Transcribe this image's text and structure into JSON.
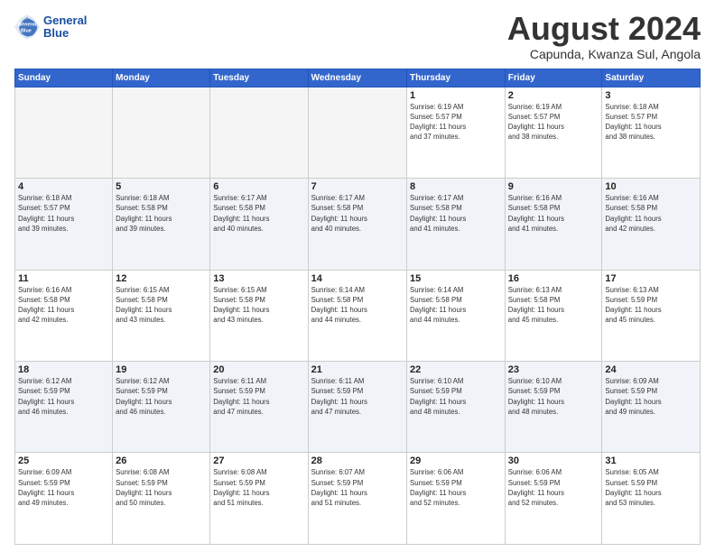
{
  "header": {
    "logo_line1": "General",
    "logo_line2": "Blue",
    "month": "August 2024",
    "location": "Capunda, Kwanza Sul, Angola"
  },
  "weekdays": [
    "Sunday",
    "Monday",
    "Tuesday",
    "Wednesday",
    "Thursday",
    "Friday",
    "Saturday"
  ],
  "rows": [
    [
      {
        "day": "",
        "info": ""
      },
      {
        "day": "",
        "info": ""
      },
      {
        "day": "",
        "info": ""
      },
      {
        "day": "",
        "info": ""
      },
      {
        "day": "1",
        "info": "Sunrise: 6:19 AM\nSunset: 5:57 PM\nDaylight: 11 hours\nand 37 minutes."
      },
      {
        "day": "2",
        "info": "Sunrise: 6:19 AM\nSunset: 5:57 PM\nDaylight: 11 hours\nand 38 minutes."
      },
      {
        "day": "3",
        "info": "Sunrise: 6:18 AM\nSunset: 5:57 PM\nDaylight: 11 hours\nand 38 minutes."
      }
    ],
    [
      {
        "day": "4",
        "info": "Sunrise: 6:18 AM\nSunset: 5:57 PM\nDaylight: 11 hours\nand 39 minutes."
      },
      {
        "day": "5",
        "info": "Sunrise: 6:18 AM\nSunset: 5:58 PM\nDaylight: 11 hours\nand 39 minutes."
      },
      {
        "day": "6",
        "info": "Sunrise: 6:17 AM\nSunset: 5:58 PM\nDaylight: 11 hours\nand 40 minutes."
      },
      {
        "day": "7",
        "info": "Sunrise: 6:17 AM\nSunset: 5:58 PM\nDaylight: 11 hours\nand 40 minutes."
      },
      {
        "day": "8",
        "info": "Sunrise: 6:17 AM\nSunset: 5:58 PM\nDaylight: 11 hours\nand 41 minutes."
      },
      {
        "day": "9",
        "info": "Sunrise: 6:16 AM\nSunset: 5:58 PM\nDaylight: 11 hours\nand 41 minutes."
      },
      {
        "day": "10",
        "info": "Sunrise: 6:16 AM\nSunset: 5:58 PM\nDaylight: 11 hours\nand 42 minutes."
      }
    ],
    [
      {
        "day": "11",
        "info": "Sunrise: 6:16 AM\nSunset: 5:58 PM\nDaylight: 11 hours\nand 42 minutes."
      },
      {
        "day": "12",
        "info": "Sunrise: 6:15 AM\nSunset: 5:58 PM\nDaylight: 11 hours\nand 43 minutes."
      },
      {
        "day": "13",
        "info": "Sunrise: 6:15 AM\nSunset: 5:58 PM\nDaylight: 11 hours\nand 43 minutes."
      },
      {
        "day": "14",
        "info": "Sunrise: 6:14 AM\nSunset: 5:58 PM\nDaylight: 11 hours\nand 44 minutes."
      },
      {
        "day": "15",
        "info": "Sunrise: 6:14 AM\nSunset: 5:58 PM\nDaylight: 11 hours\nand 44 minutes."
      },
      {
        "day": "16",
        "info": "Sunrise: 6:13 AM\nSunset: 5:58 PM\nDaylight: 11 hours\nand 45 minutes."
      },
      {
        "day": "17",
        "info": "Sunrise: 6:13 AM\nSunset: 5:59 PM\nDaylight: 11 hours\nand 45 minutes."
      }
    ],
    [
      {
        "day": "18",
        "info": "Sunrise: 6:12 AM\nSunset: 5:59 PM\nDaylight: 11 hours\nand 46 minutes."
      },
      {
        "day": "19",
        "info": "Sunrise: 6:12 AM\nSunset: 5:59 PM\nDaylight: 11 hours\nand 46 minutes."
      },
      {
        "day": "20",
        "info": "Sunrise: 6:11 AM\nSunset: 5:59 PM\nDaylight: 11 hours\nand 47 minutes."
      },
      {
        "day": "21",
        "info": "Sunrise: 6:11 AM\nSunset: 5:59 PM\nDaylight: 11 hours\nand 47 minutes."
      },
      {
        "day": "22",
        "info": "Sunrise: 6:10 AM\nSunset: 5:59 PM\nDaylight: 11 hours\nand 48 minutes."
      },
      {
        "day": "23",
        "info": "Sunrise: 6:10 AM\nSunset: 5:59 PM\nDaylight: 11 hours\nand 48 minutes."
      },
      {
        "day": "24",
        "info": "Sunrise: 6:09 AM\nSunset: 5:59 PM\nDaylight: 11 hours\nand 49 minutes."
      }
    ],
    [
      {
        "day": "25",
        "info": "Sunrise: 6:09 AM\nSunset: 5:59 PM\nDaylight: 11 hours\nand 49 minutes."
      },
      {
        "day": "26",
        "info": "Sunrise: 6:08 AM\nSunset: 5:59 PM\nDaylight: 11 hours\nand 50 minutes."
      },
      {
        "day": "27",
        "info": "Sunrise: 6:08 AM\nSunset: 5:59 PM\nDaylight: 11 hours\nand 51 minutes."
      },
      {
        "day": "28",
        "info": "Sunrise: 6:07 AM\nSunset: 5:59 PM\nDaylight: 11 hours\nand 51 minutes."
      },
      {
        "day": "29",
        "info": "Sunrise: 6:06 AM\nSunset: 5:59 PM\nDaylight: 11 hours\nand 52 minutes."
      },
      {
        "day": "30",
        "info": "Sunrise: 6:06 AM\nSunset: 5:59 PM\nDaylight: 11 hours\nand 52 minutes."
      },
      {
        "day": "31",
        "info": "Sunrise: 6:05 AM\nSunset: 5:59 PM\nDaylight: 11 hours\nand 53 minutes."
      }
    ]
  ]
}
